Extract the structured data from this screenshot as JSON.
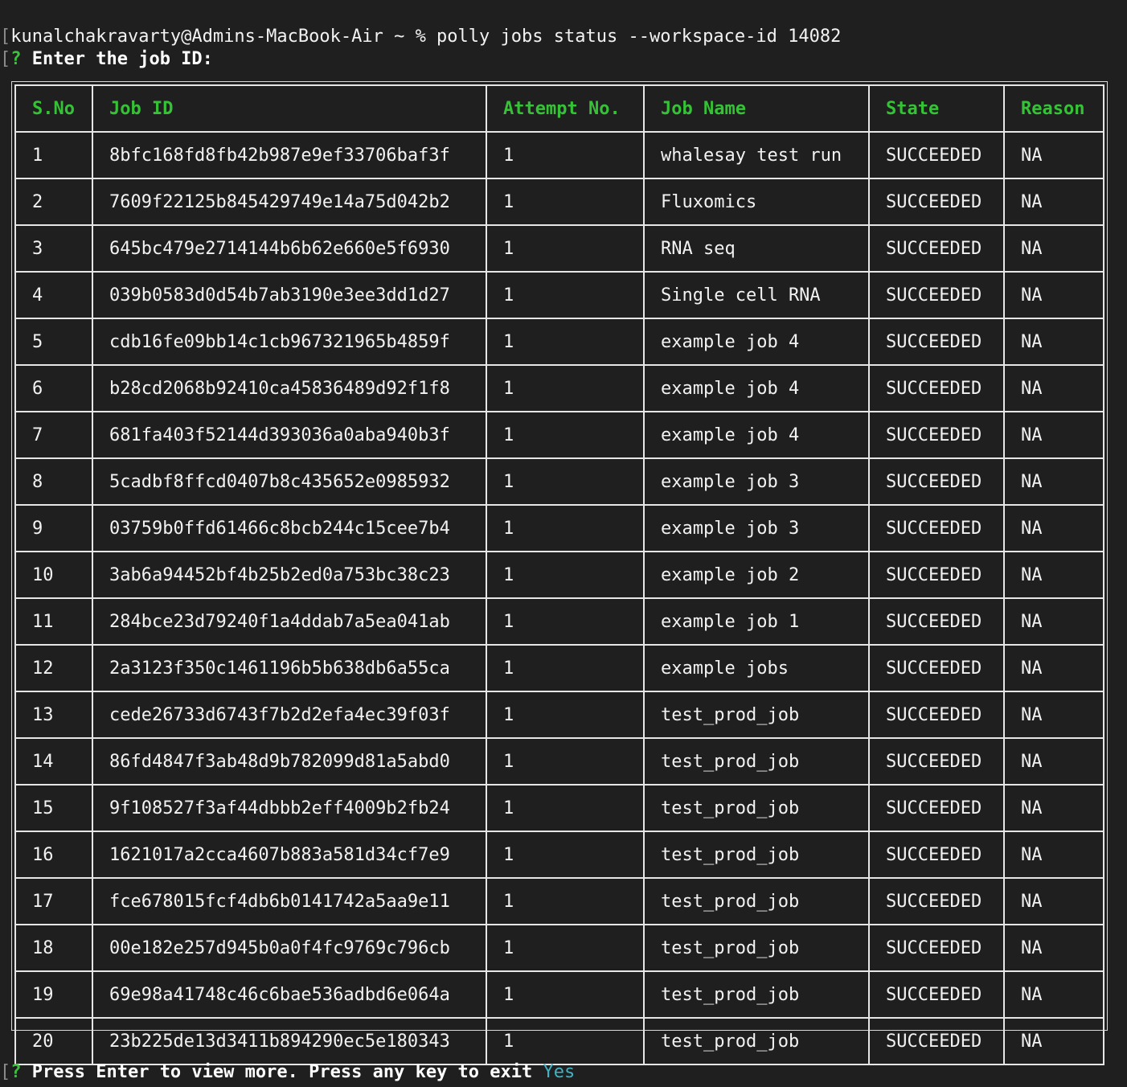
{
  "terminal": {
    "bracket": "[",
    "command": "kunalchakravarty@Admins-MacBook-Air ~ % polly jobs status --workspace-id 14082",
    "prompt_mark": "?",
    "prompt_text": "Enter the job ID:",
    "footer_text": "Press Enter to view more. Press any key to exit",
    "footer_answer": "Yes"
  },
  "table": {
    "headers": [
      "S.No",
      "Job ID",
      "Attempt No.",
      "Job Name",
      "State",
      "Reason"
    ],
    "rows": [
      [
        "1",
        "8bfc168fd8fb42b987e9ef33706baf3f",
        "1",
        "whalesay test run",
        "SUCCEEDED",
        "NA"
      ],
      [
        "2",
        "7609f22125b845429749e14a75d042b2",
        "1",
        "Fluxomics",
        "SUCCEEDED",
        "NA"
      ],
      [
        "3",
        "645bc479e2714144b6b62e660e5f6930",
        "1",
        "RNA seq",
        "SUCCEEDED",
        "NA"
      ],
      [
        "4",
        "039b0583d0d54b7ab3190e3ee3dd1d27",
        "1",
        "Single cell RNA",
        "SUCCEEDED",
        "NA"
      ],
      [
        "5",
        "cdb16fe09bb14c1cb967321965b4859f",
        "1",
        "example job 4",
        "SUCCEEDED",
        "NA"
      ],
      [
        "6",
        "b28cd2068b92410ca45836489d92f1f8",
        "1",
        "example job 4",
        "SUCCEEDED",
        "NA"
      ],
      [
        "7",
        "681fa403f52144d393036a0aba940b3f",
        "1",
        "example job 4",
        "SUCCEEDED",
        "NA"
      ],
      [
        "8",
        "5cadbf8ffcd0407b8c435652e0985932",
        "1",
        "example job 3",
        "SUCCEEDED",
        "NA"
      ],
      [
        "9",
        "03759b0ffd61466c8bcb244c15cee7b4",
        "1",
        "example job 3",
        "SUCCEEDED",
        "NA"
      ],
      [
        "10",
        "3ab6a94452bf4b25b2ed0a753bc38c23",
        "1",
        "example job 2",
        "SUCCEEDED",
        "NA"
      ],
      [
        "11",
        "284bce23d79240f1a4ddab7a5ea041ab",
        "1",
        "example job 1",
        "SUCCEEDED",
        "NA"
      ],
      [
        "12",
        "2a3123f350c1461196b5b638db6a55ca",
        "1",
        "example jobs",
        "SUCCEEDED",
        "NA"
      ],
      [
        "13",
        "cede26733d6743f7b2d2efa4ec39f03f",
        "1",
        "test_prod_job",
        "SUCCEEDED",
        "NA"
      ],
      [
        "14",
        "86fd4847f3ab48d9b782099d81a5abd0",
        "1",
        "test_prod_job",
        "SUCCEEDED",
        "NA"
      ],
      [
        "15",
        "9f108527f3af44dbbb2eff4009b2fb24",
        "1",
        "test_prod_job",
        "SUCCEEDED",
        "NA"
      ],
      [
        "16",
        "1621017a2cca4607b883a581d34cf7e9",
        "1",
        "test_prod_job",
        "SUCCEEDED",
        "NA"
      ],
      [
        "17",
        "fce678015fcf4db6b0141742a5aa9e11",
        "1",
        "test_prod_job",
        "SUCCEEDED",
        "NA"
      ],
      [
        "18",
        "00e182e257d945b0a0f4fc9769c796cb",
        "1",
        "test_prod_job",
        "SUCCEEDED",
        "NA"
      ],
      [
        "19",
        "69e98a41748c46c6bae536adbd6e064a",
        "1",
        "test_prod_job",
        "SUCCEEDED",
        "NA"
      ],
      [
        "20",
        "23b225de13d3411b894290ec5e180343",
        "1",
        "test_prod_job",
        "SUCCEEDED",
        "NA"
      ]
    ]
  },
  "colors": {
    "background": "#1f1f1f",
    "text": "#f2f2f2",
    "header_green": "#36c236",
    "answer_cyan": "#3fb4c4"
  }
}
